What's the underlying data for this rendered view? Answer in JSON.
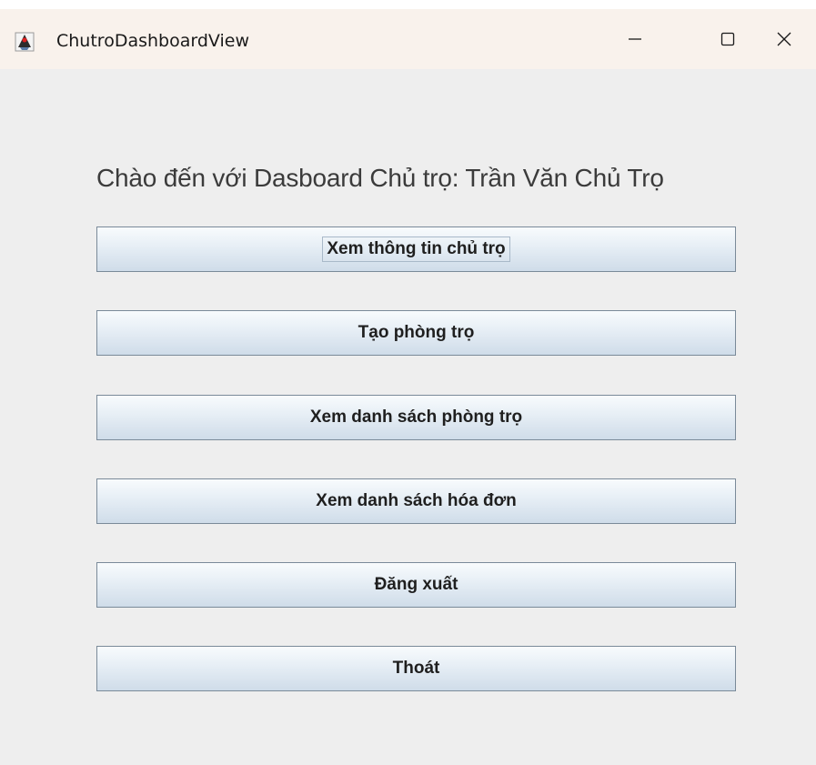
{
  "window": {
    "title": "ChutroDashboardView",
    "app_icon": "java-duke-icon",
    "controls": {
      "minimize_icon": "minimize-icon",
      "maximize_icon": "maximize-icon",
      "close_icon": "close-icon"
    }
  },
  "main": {
    "welcome_text": "Chào đến với Dasboard Chủ trọ: Trần Văn Chủ Trọ",
    "buttons": [
      {
        "label": "Xem thông tin chủ trọ"
      },
      {
        "label": "Tạo phòng trọ"
      },
      {
        "label": "Xem danh sách phòng trọ"
      },
      {
        "label": "Xem danh sách hóa đơn"
      },
      {
        "label": "Đăng xuất"
      },
      {
        "label": "Thoát"
      }
    ]
  },
  "colors": {
    "titlebar_bg": "#f9f2ec",
    "content_bg": "#eeeeee",
    "button_border": "#7a8a99"
  }
}
